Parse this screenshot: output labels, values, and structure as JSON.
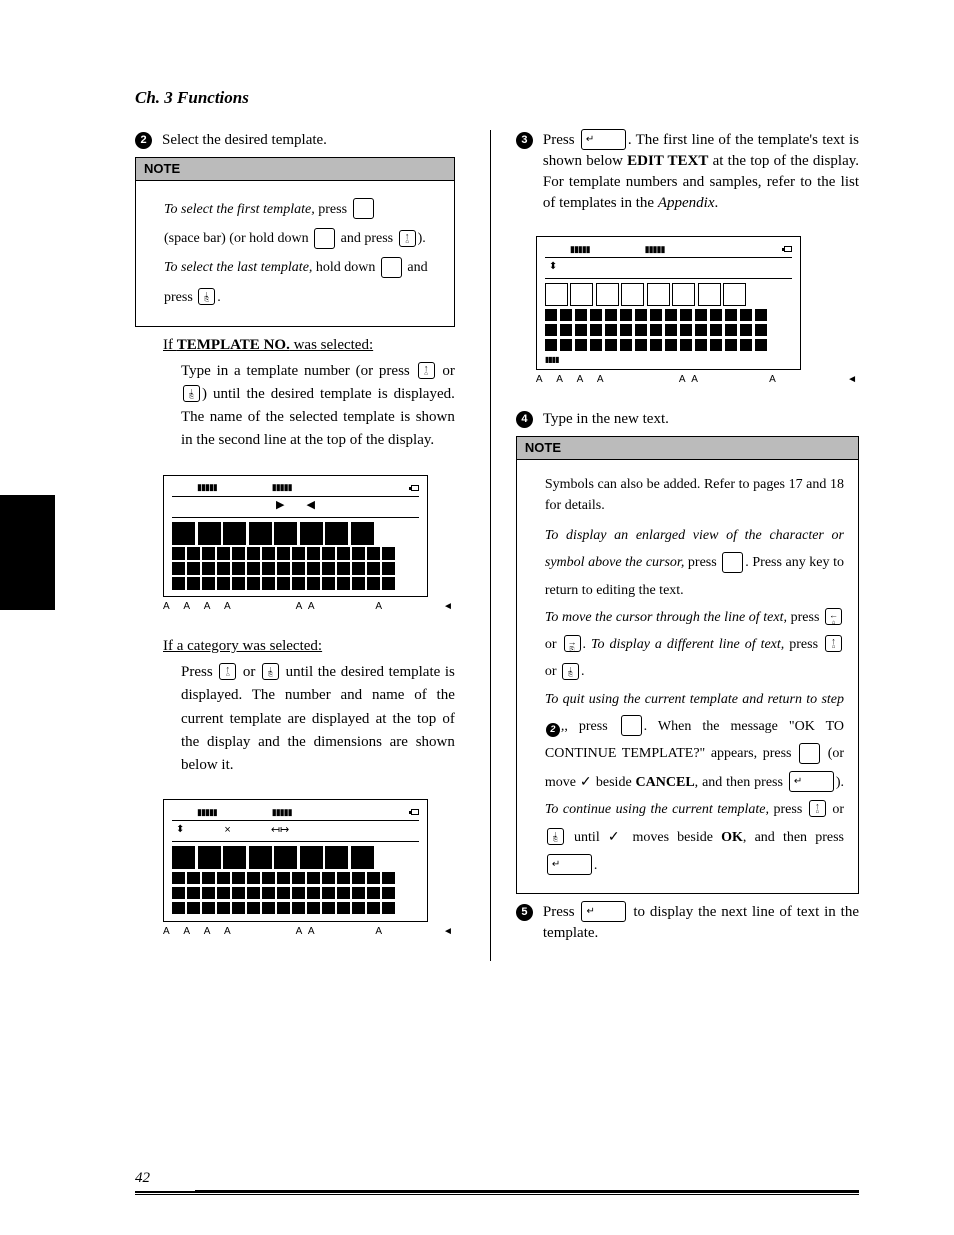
{
  "chapter": "Ch. 3 Functions",
  "page_number": "42",
  "left": {
    "step2": {
      "num": "2",
      "text": "Select the desired template."
    },
    "note1": {
      "header": "NOTE",
      "line1_ital": "To select the first template,",
      "line1_tail": " press ",
      "line2_head": "(space bar) (or hold down ",
      "line2_mid": " and press ",
      "line2_tail": ").",
      "line3_ital": "To select the last template,",
      "line3_tail": " hold down ",
      "line3_end": " and",
      "line4": "press ",
      "line4_tail": "."
    },
    "if_template": {
      "head_pre": "If ",
      "head_bold": "TEMPLATE NO.",
      "head_post": " was selected:",
      "body1": "Type in a template number (or press ",
      "body_or": " or ",
      "body_tail": ") until the desired template is displayed. The name of the selected template is shown in the second line at the top of the display."
    },
    "if_category": {
      "head": "If a category was selected:",
      "body1": "Press ",
      "body_or": " or ",
      "body_tail": " until the desired template is displayed. The number and name of the current template are displayed at the top of the display and the dimensions are shown below it."
    }
  },
  "right": {
    "step3": {
      "num": "3",
      "text_pre": "Press ",
      "text_post": ". The first line of the template's text is shown below ",
      "edit_text": "EDIT TEXT",
      "text_end": " at the top of the display. For template numbers and samples, refer to the list of templates in the ",
      "appendix": "Appendix",
      "period": "."
    },
    "step4": {
      "num": "4",
      "text": "Type in the new text."
    },
    "note2": {
      "header": "NOTE",
      "l1": "Symbols can also be added. Refer to pages 17 and 18 for details.",
      "l2_ital": "To display an enlarged view of the character or symbol above the cursor,",
      "l2_tail": " press ",
      "l2_end": ". Press any key to return to editing the text.",
      "l3_ital": "To move the cursor through the line of text,",
      "l3_press": "press ",
      "l3_or": " or ",
      "l3_period": ". ",
      "l3b_ital": "To display a different line of text,",
      "l3b_press": " press ",
      "l3b_or": " or ",
      "l3b_period": ".",
      "l4_ital": "To quit using the current template and return to step ",
      "l4_stepref": "2",
      "l4_tail": ", press ",
      "l4_end": ". When the message \"OK TO CONTINUE TEMPLATE?\" appears, press ",
      "l4_ormove": "(or move ",
      "l4_beside": " beside ",
      "cancel": "CANCEL",
      "l4_then": ", and then press ",
      "l4_close": "). ",
      "l5_ital": "To continue using the current template,",
      "l5_press": " press ",
      "l5_or": " or ",
      "l5_until": " until ",
      "l5_moves": " moves beside ",
      "ok": "OK",
      "l5_then": ", and then press ",
      "l5_period": "."
    },
    "step5": {
      "num": "5",
      "text_pre": "Press ",
      "text_post": " to display the next line of text in the template."
    }
  },
  "lcd_footer": {
    "left_group": "A A A A",
    "mid": "A A",
    "right_a": "A",
    "arrow": "◄"
  }
}
